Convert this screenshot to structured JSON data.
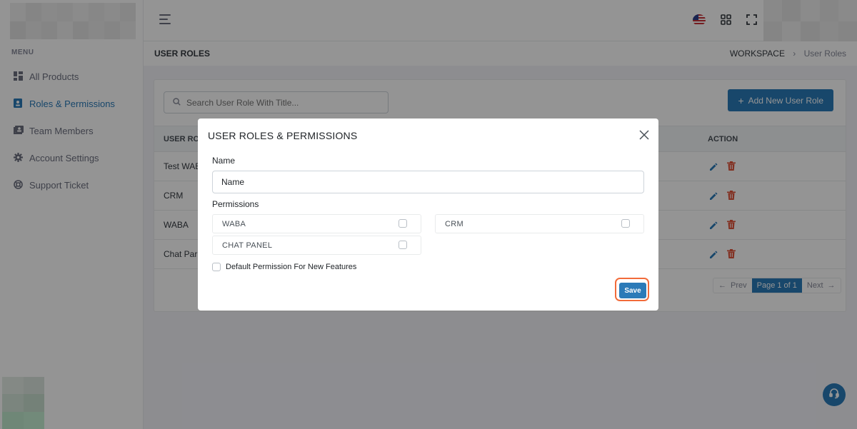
{
  "sidebar": {
    "menu_title": "MENU",
    "items": [
      {
        "label": "All Products",
        "icon": "grid-icon"
      },
      {
        "label": "Roles & Permissions",
        "icon": "badge-icon",
        "active": true
      },
      {
        "label": "Team Members",
        "icon": "team-icon"
      },
      {
        "label": "Account Settings",
        "icon": "gear-icon"
      },
      {
        "label": "Support Ticket",
        "icon": "lifebuoy-icon"
      }
    ]
  },
  "header": {
    "page_title": "USER ROLES",
    "breadcrumb": {
      "root": "WORKSPACE",
      "separator": "›",
      "current": "User Roles"
    }
  },
  "toolbar": {
    "search_placeholder": "Search User Role With Title...",
    "add_button_label": "Add New User Role"
  },
  "table": {
    "columns": {
      "role": "USER RO",
      "action": "ACTION"
    },
    "rows": [
      {
        "name": "Test WAB"
      },
      {
        "name": "CRM"
      },
      {
        "name": "WABA"
      },
      {
        "name": "Chat Par"
      }
    ]
  },
  "pagination": {
    "prev": "Prev",
    "current": "Page 1 of 1",
    "next": "Next"
  },
  "modal": {
    "title": "USER ROLES & PERMISSIONS",
    "name_label": "Name",
    "name_placeholder": "Name",
    "permissions_label": "Permissions",
    "permissions": [
      {
        "label": "WABA",
        "checked": false
      },
      {
        "label": "CRM",
        "checked": false
      },
      {
        "label": "CHAT PANEL",
        "checked": false
      }
    ],
    "default_permission_label": "Default Permission For New Features",
    "save_label": "Save"
  },
  "colors": {
    "accent": "#2a7ab8",
    "danger": "#e0533a",
    "highlight": "#f26b3a"
  }
}
